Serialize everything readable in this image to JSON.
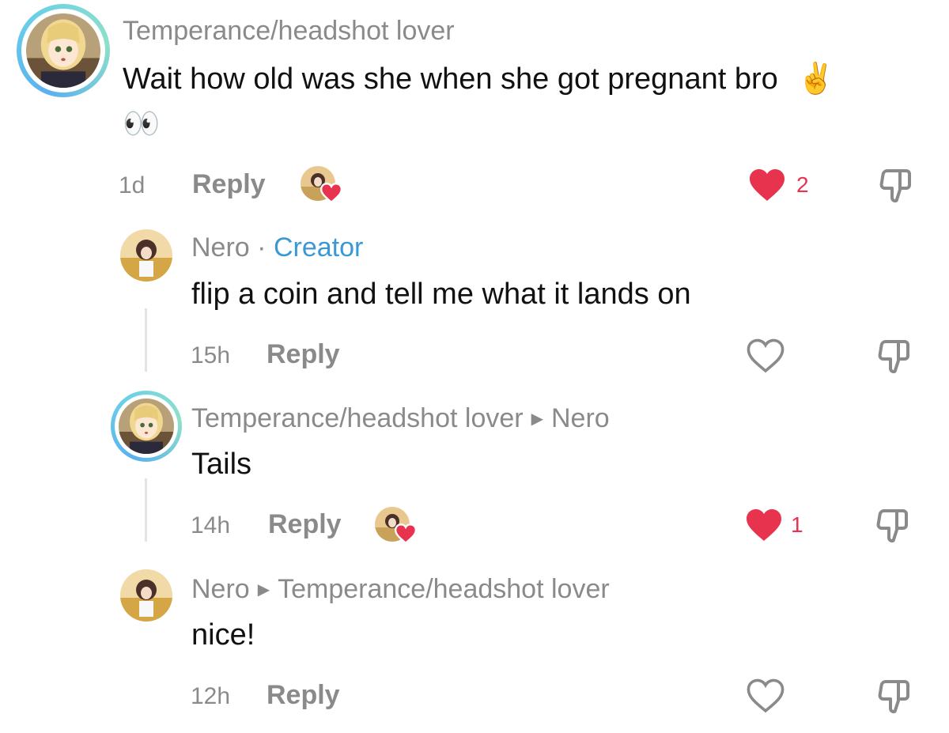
{
  "comments": [
    {
      "username": "Temperance/headshot lover",
      "text": "Wait how old was she when she got pregnant bro",
      "emoji_inline": "✌️",
      "emoji_line2": "👀",
      "time": "1d",
      "reply_label": "Reply",
      "likes": "2",
      "liked": true,
      "creator_liked": true
    },
    {
      "username": "Nero",
      "separator": "·",
      "badge": "Creator",
      "text": "flip a coin and tell me what it lands on",
      "time": "15h",
      "reply_label": "Reply",
      "liked": false
    },
    {
      "username": "Temperance/headshot lover",
      "reply_to": "Nero",
      "text": "Tails",
      "time": "14h",
      "reply_label": "Reply",
      "likes": "1",
      "liked": true,
      "creator_liked": true
    },
    {
      "username": "Nero",
      "reply_to": "Temperance/headshot lover",
      "text": "nice!",
      "time": "12h",
      "reply_label": "Reply",
      "liked": false
    }
  ],
  "icons": {
    "reply_arrow": "triangle-right-icon",
    "like": "heart-icon",
    "dislike": "thumbs-down-icon"
  },
  "colors": {
    "like_red": "#e8334f",
    "creator_blue": "#3a98d6",
    "meta_gray": "#8a8a8a"
  }
}
